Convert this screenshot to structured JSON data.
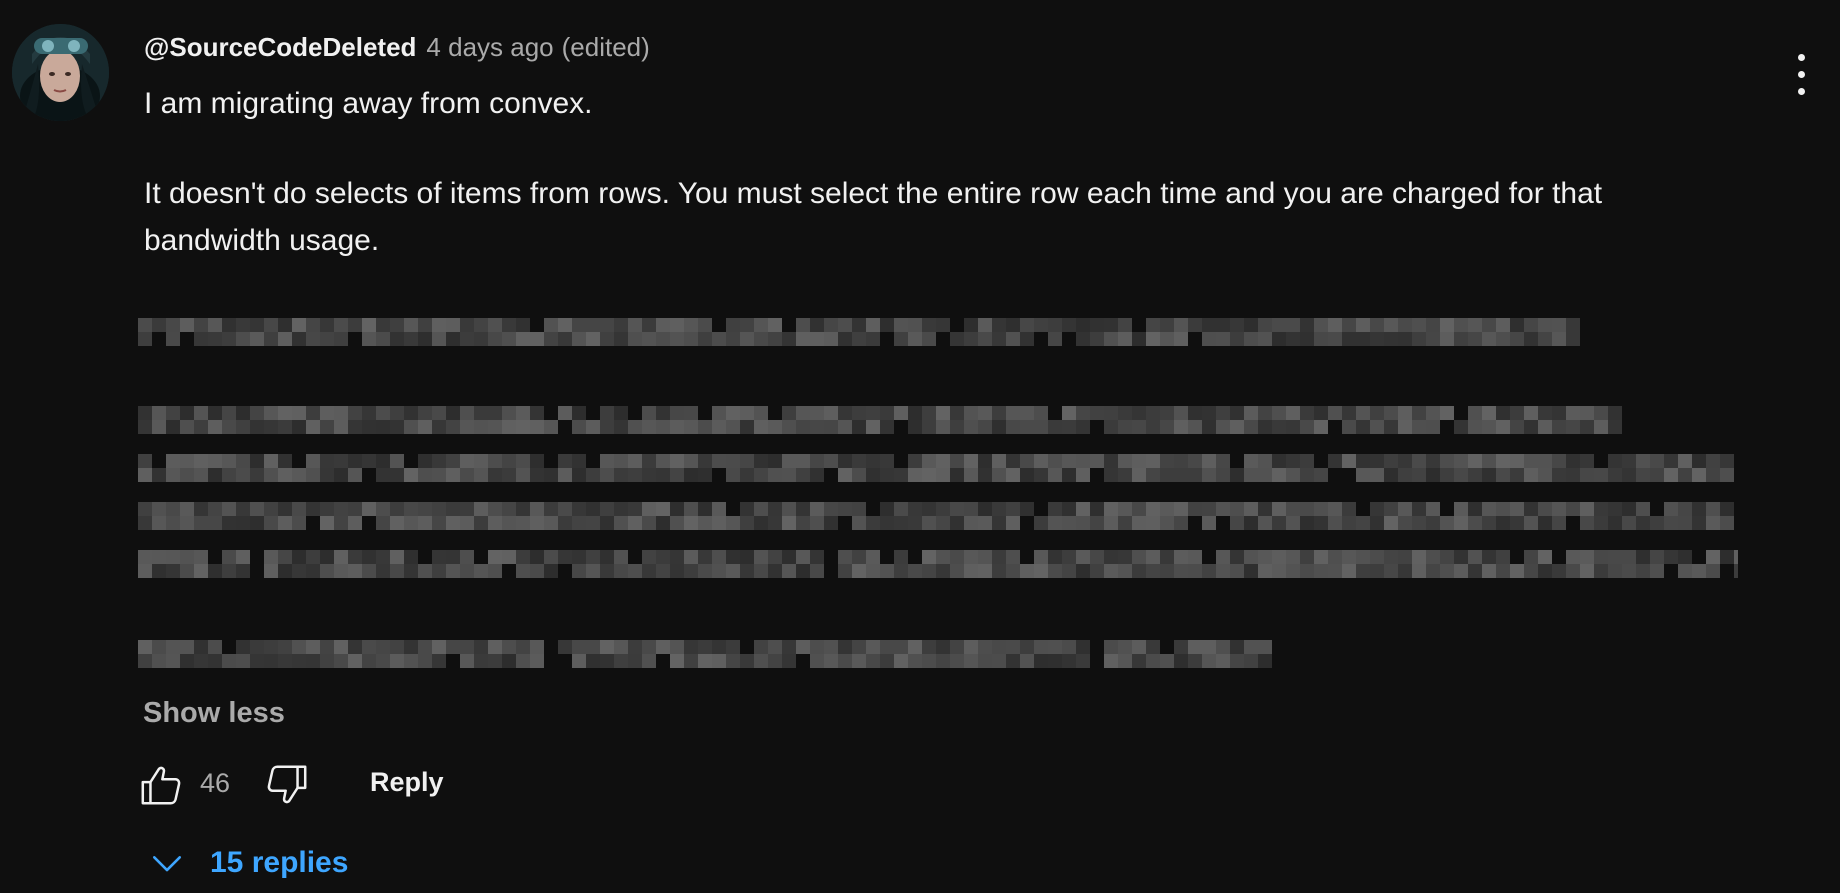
{
  "comment": {
    "author": "@SourceCodeDeleted",
    "time": "4 days ago",
    "edited": "(edited)",
    "lines": [
      "I am migrating away from convex.",
      "It doesn't do selects of items from rows. You must select the entire row each time and you are charged for that",
      "bandwidth usage."
    ],
    "show_less": "Show less",
    "like_count": "46",
    "reply_label": "Reply",
    "replies_label": "15 replies"
  },
  "icons": {
    "avatar": "avatar",
    "menu": "three-dots-vertical-icon",
    "like": "thumbs-up-icon",
    "dislike": "thumbs-down-icon",
    "replies": "chevron-down-icon"
  },
  "colors": {
    "background": "#0f0f0f",
    "text": "#f1f1f1",
    "secondary_text": "#aaaaaa",
    "link_blue": "#3ea6ff"
  }
}
